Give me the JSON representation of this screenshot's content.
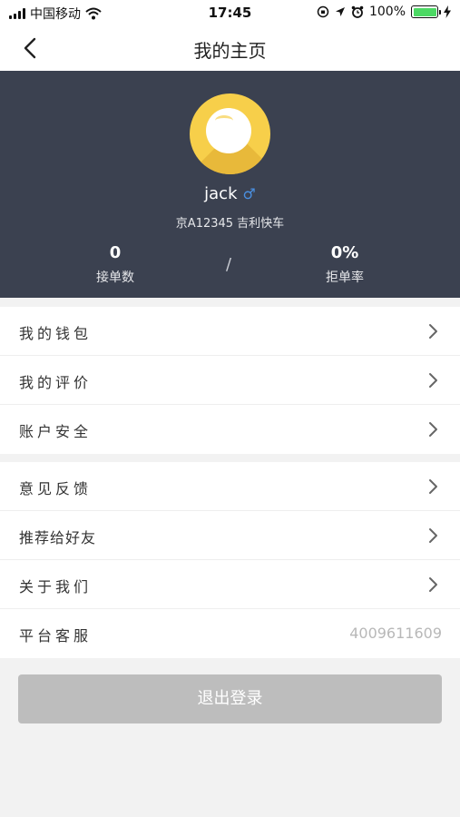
{
  "status_bar": {
    "carrier": "中国移动",
    "time": "17:45",
    "battery": "100%"
  },
  "nav": {
    "title": "我的主页"
  },
  "profile": {
    "name": "jack",
    "gender_symbol": "♂",
    "car_info": "京A12345  吉利快车",
    "stats": [
      {
        "value": "0",
        "label": "接单数"
      },
      {
        "value": "0%",
        "label": "拒单率"
      }
    ],
    "divider": "/"
  },
  "menu": {
    "group1": [
      {
        "label": "我的钱包"
      },
      {
        "label": "我的评价"
      },
      {
        "label": "账户安全"
      }
    ],
    "group2": [
      {
        "label": "意见反馈"
      },
      {
        "label": "推荐给好友"
      },
      {
        "label": "关于我们"
      },
      {
        "label": "平台客服",
        "value": "4009611609"
      }
    ]
  },
  "logout": {
    "label": "退出登录"
  },
  "colors": {
    "header_bg": "#3b4150",
    "avatar": "#f7cf4a",
    "battery": "#4cd964",
    "gender": "#4a90e2",
    "logout_bg": "#bdbdbd"
  }
}
